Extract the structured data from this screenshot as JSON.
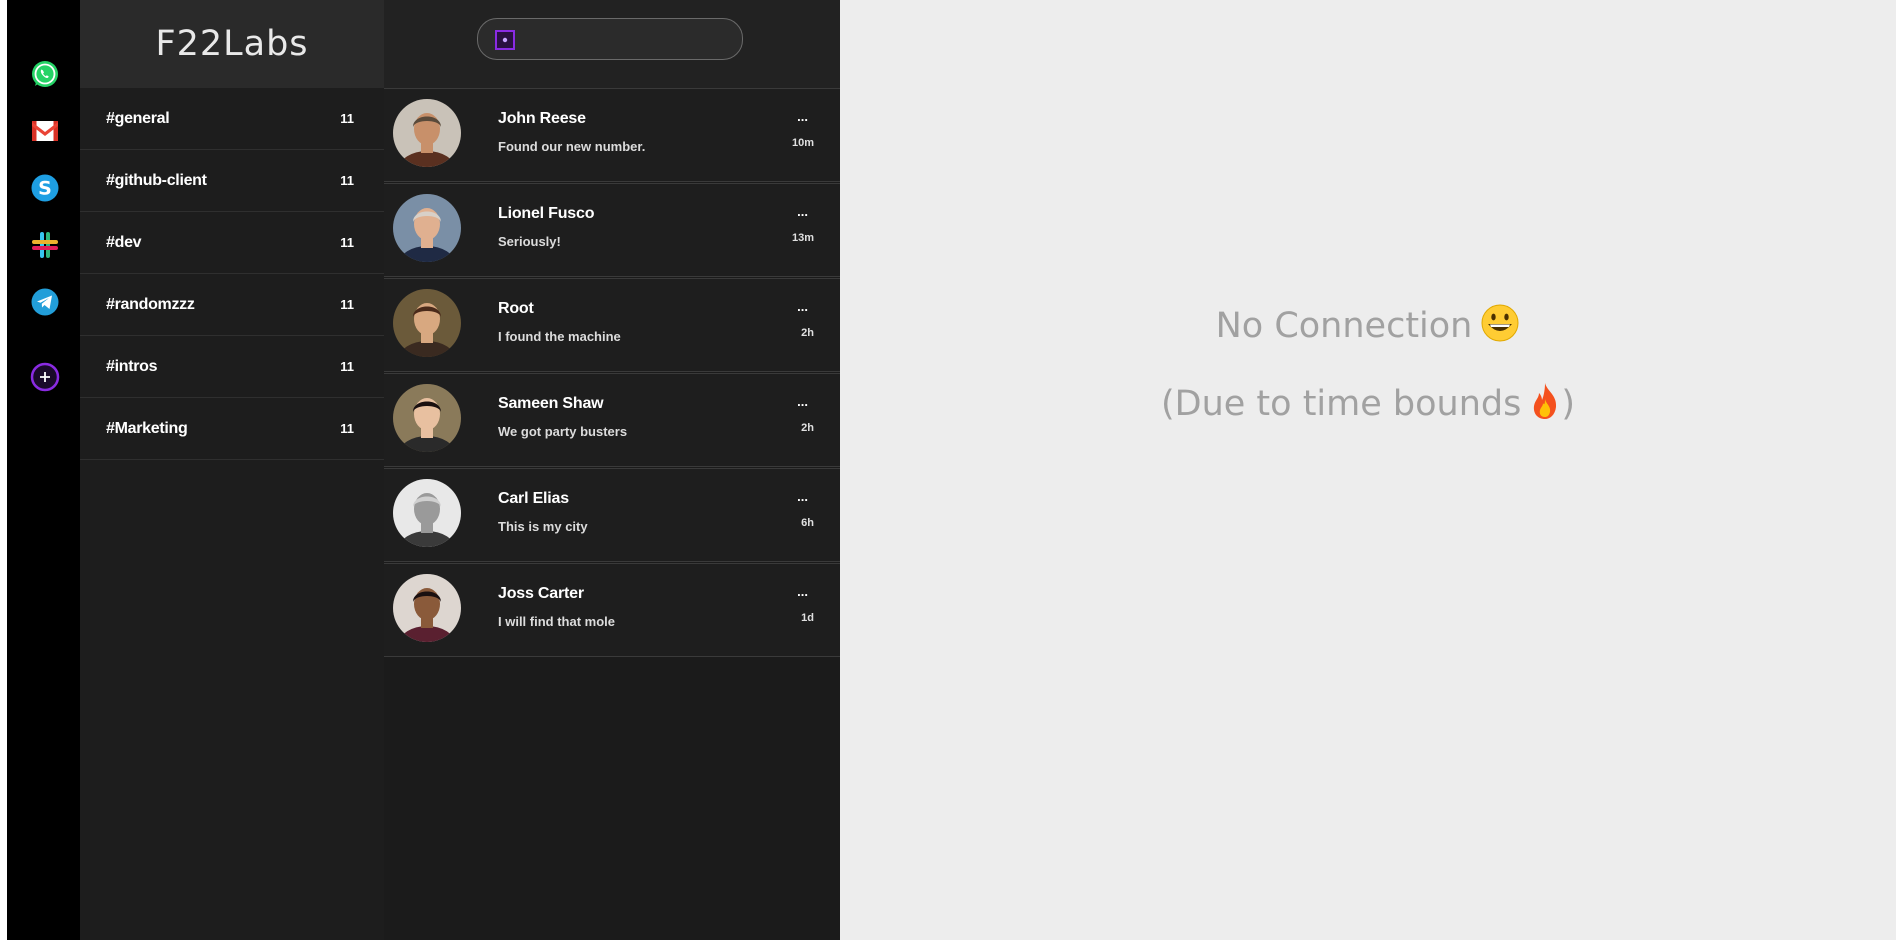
{
  "colors": {
    "rail_bg": "#000000",
    "channels_bg": "#1d1d1d",
    "brand_bg": "#2a2a2a",
    "convos_bg": "#1b1b1b",
    "main_bg": "#ededed",
    "main_text": "#a1a1a1",
    "accent": "#8a2be2"
  },
  "rail": {
    "icons": [
      {
        "name": "whatsapp-icon"
      },
      {
        "name": "gmail-icon"
      },
      {
        "name": "skype-icon"
      },
      {
        "name": "slack-icon"
      },
      {
        "name": "telegram-icon"
      },
      {
        "name": "add-icon"
      }
    ]
  },
  "brand": {
    "title": "F22Labs"
  },
  "channels": [
    {
      "name": "#general",
      "count": "11"
    },
    {
      "name": "#github-client",
      "count": "11"
    },
    {
      "name": "#dev",
      "count": "11"
    },
    {
      "name": "#randomzzz",
      "count": "11"
    },
    {
      "name": "#intros",
      "count": "11"
    },
    {
      "name": "#Marketing",
      "count": "11"
    }
  ],
  "search": {
    "value": "",
    "placeholder": ""
  },
  "conversations": [
    {
      "name": "John Reese",
      "message": "Found our new number.",
      "more": "...",
      "time": "10m"
    },
    {
      "name": "Lionel Fusco",
      "message": "Seriously!",
      "more": "...",
      "time": "13m"
    },
    {
      "name": "Root",
      "message": "I found the machine",
      "more": "...",
      "time": "2h"
    },
    {
      "name": "Sameen Shaw",
      "message": "We got party busters",
      "more": "...",
      "time": "2h"
    },
    {
      "name": "Carl Elias",
      "message": "This is my city",
      "more": "...",
      "time": "6h"
    },
    {
      "name": "Joss Carter",
      "message": "I will find that mole",
      "more": "...",
      "time": "1d"
    }
  ],
  "main": {
    "line1": "No Connection",
    "line1_emoji": "smiley-emoji",
    "line2_prefix": "(Due to time bounds",
    "line2_emoji": "fire-emoji",
    "line2_suffix": ")"
  }
}
